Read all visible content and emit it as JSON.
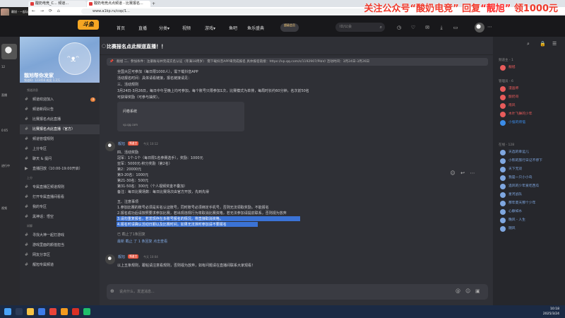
{
  "browser": {
    "tab1_title": "酸奶电竞_C... 频道...",
    "tab2_title": "酸奶电竞点点频道 - 比赛报名...",
    "url": "www.a1kp.ru/cop/1...",
    "overlay_prefix": "关注公众号",
    "overlay_quote": "“酸奶电竞”",
    "overlay_mid": "回复",
    "overlay_quote2": "“靓旭”",
    "overlay_suffix": "领1000元"
  },
  "streamer": {
    "name": "靓旭 - 一起玩"
  },
  "header": {
    "logo": "斗鱼",
    "nav": [
      "首页",
      "直播",
      "分类▾",
      "视频",
      "游戏▾",
      "鱼吧",
      "鱼乐盛典"
    ],
    "vip": "超级会员",
    "search_placeholder": "ID/公会"
  },
  "leftstrip": [
    "12",
    "直播",
    "0:05",
    "进行中",
    "视频"
  ],
  "sidebar": {
    "channel_name": "靓旭帮你发家",
    "channel_sub": "频道ID: 123456   成员 1.2万",
    "group1": "频道消息",
    "items": [
      {
        "label": "频道欢迎加入",
        "badge": "3"
      },
      {
        "label": "频道新闻公告"
      },
      {
        "label": "比赛报名点此直播"
      },
      {
        "label": "比赛报名点此直播（官方）"
      },
      {
        "label": "频道管理规则"
      },
      {
        "label": "上分专区"
      },
      {
        "label": "聊天 & 提问"
      },
      {
        "label": "直播回放（10:00-19:00开启）"
      }
    ],
    "group2": "上分",
    "items2": [
      {
        "label": "专属直播区频道规则"
      },
      {
        "label": "打开专属直播间看看"
      },
      {
        "label": "我的专区"
      },
      {
        "label": "黑神话：悟空"
      }
    ],
    "group3": "闲聊",
    "items3": [
      {
        "label": "寻找大神一起打游戏"
      },
      {
        "label": "游戏里面的颜值担当"
      },
      {
        "label": "网友分享区"
      },
      {
        "label": "靓旭专属频道"
      }
    ]
  },
  "main": {
    "title": "比赛报名点此频道直播！！",
    "notice": "靓旭   二、参加条件：注册账号并完成实名认证（年满18周岁）  需下载抖音APP来完成报名  具体报名链接：https://vp.qq.com/s/1192907/PibV/  活动时间：3月24日-3月26日",
    "post1_lines": [
      "全国大区可参加（每日限1000人），需下载抖音APP",
      "活动报名时间：具体请看链接，报名链接请见：",
      "三、活动规则",
      "3月24日-3月26日，每日中午至晚上均可参加，每个账号只限参加1次，比赛模式为单排，每局时长约60分钟，名次前50名",
      "可获得奖励（可参与抽奖）。"
    ],
    "card_title": "问卷系统",
    "card_link": "vp.qq.com",
    "post2_user": "靓旭",
    "post2_tag": "频道主",
    "post2_time": "今天 10:12",
    "post2_lines": [
      "四、活动奖励",
      "冠军：1个-1个（每日限1名参赛选手），奖励：1000元",
      "亚军：5000元-积分奖励（第2名）",
      "第2：20000元",
      "第3-20名：1000元",
      "第21-30名：500元",
      "第31-50名：300元（个人视频奖金不叠加）",
      "备注：每日比赛场数：每日比赛场次由官方开放，先到先得"
    ],
    "post2_lines2": [
      "五、注意事项",
      "1.参加比赛的账号必须是实名认证账号，同时账号必须绑定手机号，否则无法领取奖励，不能报名",
      "2.报名成功后请按照要求参加比赛，若出现违规行为将取消比赛资格，若无法参加请提前联系，否则视为放弃",
      "3.请勿重复报名，若发现存在多账号报名的情况，将直接取消资格。",
      "4.报名时请确认活动日期以及比赛时间，如果无法准时参加请不要报名"
    ],
    "reaction_line": "已 截止了1条回复",
    "reply_hint": "最新 截止 了 1 条回复  点击查看",
    "post3_user": "靓旭",
    "post3_tag": "频道主",
    "post3_time": "今天 10:04",
    "post3_text": "以上五条规则，跟帖请注意看规则，否则视为放弃，如有问题请在直播间联系大家观看！",
    "composer_placeholder": "说点什么，发送消息..."
  },
  "right": {
    "group1": "频道主 - 1",
    "group2": "管理员 - 6",
    "group3": "在线 - 128",
    "users": [
      {
        "name": "靓旭",
        "color": "#e85b5b"
      },
      {
        "name": "漫画师",
        "color": "#e85b5b"
      },
      {
        "name": "酸奶哥",
        "color": "#e85b5b"
      },
      {
        "name": "南风",
        "color": "#e85b5b"
      },
      {
        "name": "木叶飞舞的少年",
        "color": "#e85b5b"
      },
      {
        "name": "小强的烦恼",
        "color": "#3b8ce8"
      },
      {
        "name": "天选的幸运儿",
        "color": "#7fa7e0"
      },
      {
        "name": "小熊的旅行日记不停下",
        "color": "#7fa7e0"
      },
      {
        "name": "天下无双",
        "color": "#7fa7e0"
      },
      {
        "name": "我是一只小小鸟",
        "color": "#7fa7e0"
      },
      {
        "name": "追风的少年爱吃西瓜",
        "color": "#7fa7e0"
      },
      {
        "name": "星河战队",
        "color": "#7fa7e0"
      },
      {
        "name": "那年夏天那个少年",
        "color": "#7fa7e0"
      },
      {
        "name": "心静如水",
        "color": "#7fa7e0"
      },
      {
        "name": "晚风 - 人生",
        "color": "#7fa7e0"
      },
      {
        "name": "随风",
        "color": "#7fa7e0"
      }
    ]
  },
  "taskbar": {
    "time": "10:18",
    "date": "2025/3/24"
  }
}
